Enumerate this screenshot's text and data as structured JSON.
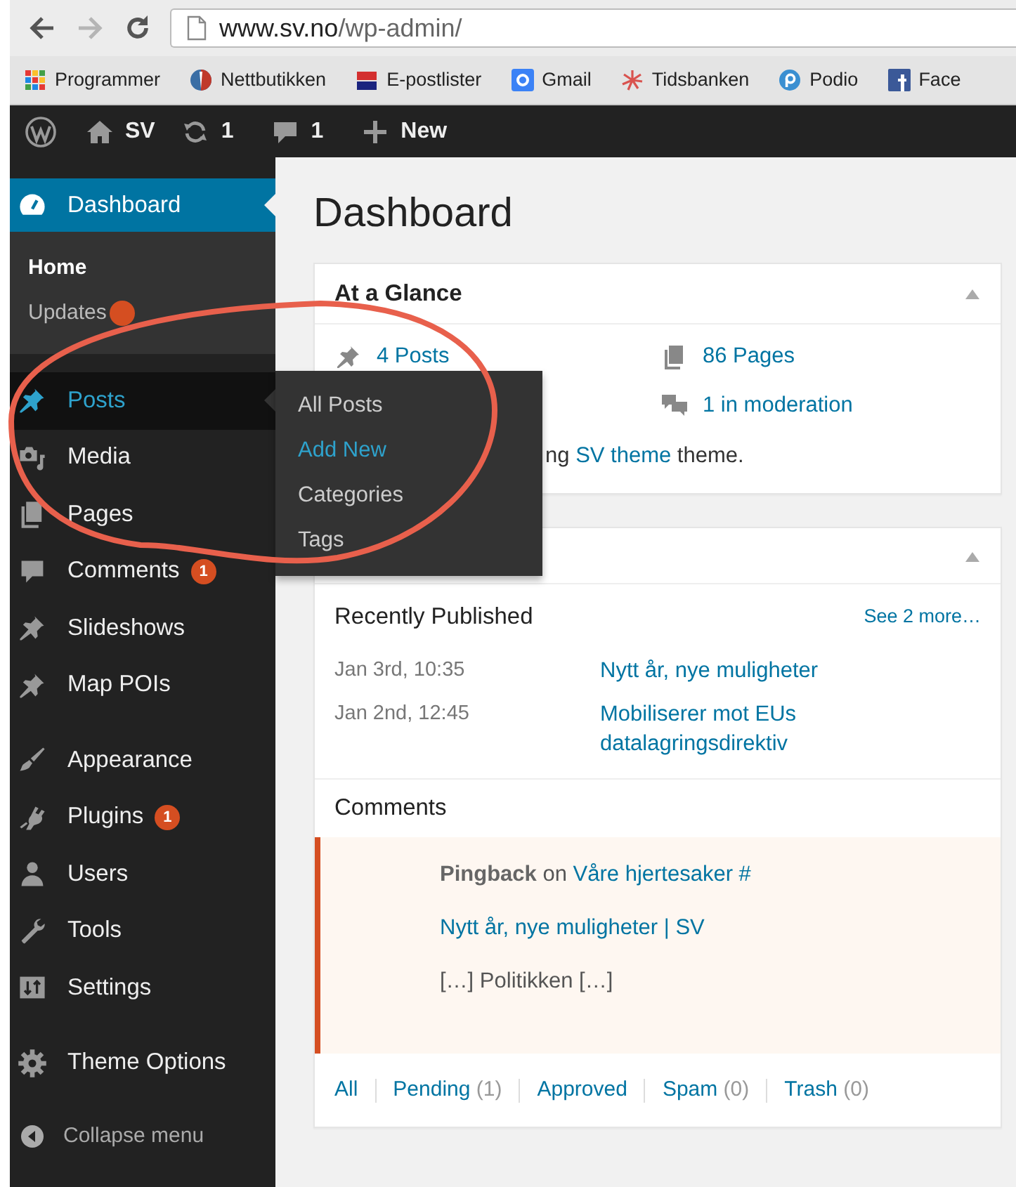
{
  "browser": {
    "url_host": "www.sv.no",
    "url_path": "/wp-admin/",
    "bookmarks": [
      {
        "label": "Programmer"
      },
      {
        "label": "Nettbutikken"
      },
      {
        "label": "E-postlister"
      },
      {
        "label": "Gmail"
      },
      {
        "label": "Tidsbanken"
      },
      {
        "label": "Podio"
      },
      {
        "label": "Face"
      }
    ]
  },
  "admin_bar": {
    "site": "SV",
    "updates": "1",
    "comments": "1",
    "new": "New"
  },
  "sidebar": {
    "groups": [
      {
        "items": [
          {
            "label": "Dashboard",
            "selected": true,
            "expanded": false,
            "children": [
              {
                "label": "Home",
                "selected": true,
                "has_badge": false
              },
              {
                "label": "Updates",
                "selected": false,
                "has_badge": true
              }
            ]
          }
        ]
      },
      {
        "items": [
          {
            "label": "Posts",
            "selected": false,
            "expanded": true,
            "children": [
              {
                "label": "All Posts",
                "selected": false
              },
              {
                "label": "Add New",
                "selected": true
              },
              {
                "label": "Categories",
                "selected": false
              },
              {
                "label": "Tags",
                "selected": false
              }
            ]
          },
          {
            "label": "Media",
            "selected": false,
            "expanded": false
          },
          {
            "label": "Pages",
            "selected": false,
            "expanded": false
          },
          {
            "label": "Comments",
            "selected": false,
            "expanded": false,
            "badge": "1"
          },
          {
            "label": "Slideshows",
            "selected": false,
            "expanded": false
          },
          {
            "label": "Map POIs",
            "selected": false,
            "expanded": false
          }
        ]
      },
      {
        "items": [
          {
            "label": "Appearance",
            "selected": false,
            "expanded": false
          },
          {
            "label": "Plugins",
            "selected": false,
            "expanded": false,
            "badge": "1"
          },
          {
            "label": "Users",
            "selected": false,
            "expanded": false
          },
          {
            "label": "Tools",
            "selected": false,
            "expanded": false
          },
          {
            "label": "Settings",
            "selected": false,
            "expanded": false
          }
        ]
      },
      {
        "items": [
          {
            "label": "Theme Options",
            "selected": false,
            "expanded": false
          }
        ]
      }
    ],
    "collapse": "Collapse menu"
  },
  "page": {
    "title": "Dashboard"
  },
  "glance": {
    "title": "At a Glance",
    "items": [
      {
        "kind": "posts",
        "label": "4 Posts"
      },
      {
        "kind": "pages",
        "label": "86 Pages"
      },
      {
        "kind": "moderation",
        "label": "1 in moderation"
      }
    ],
    "note": {
      "before": "ng ",
      "link": "SV theme",
      "after": " theme."
    }
  },
  "activity": {
    "recent": {
      "title": "Recently Published",
      "more": "See 2 more…",
      "posts": [
        {
          "date": "Jan 3rd, 10:35",
          "title": "Nytt år, nye muligheter"
        },
        {
          "date": "Jan 2nd, 12:45",
          "title": "Mobiliserer mot EUs datalagringsdirektiv"
        }
      ]
    },
    "comments": {
      "title": "Comments",
      "items": [
        {
          "type": "Pingback",
          "on": "on",
          "post": "Våre hjertesaker #",
          "author": "Nytt år, nye muligheter | SV",
          "excerpt": "[…] Politikken […]",
          "pending": true
        }
      ]
    },
    "filters": [
      {
        "label": "All"
      },
      {
        "label": "Pending",
        "count": "(1)"
      },
      {
        "label": "Approved"
      },
      {
        "label": "Spam",
        "count": "(0)"
      },
      {
        "label": "Trash",
        "count": "(0)"
      }
    ]
  }
}
